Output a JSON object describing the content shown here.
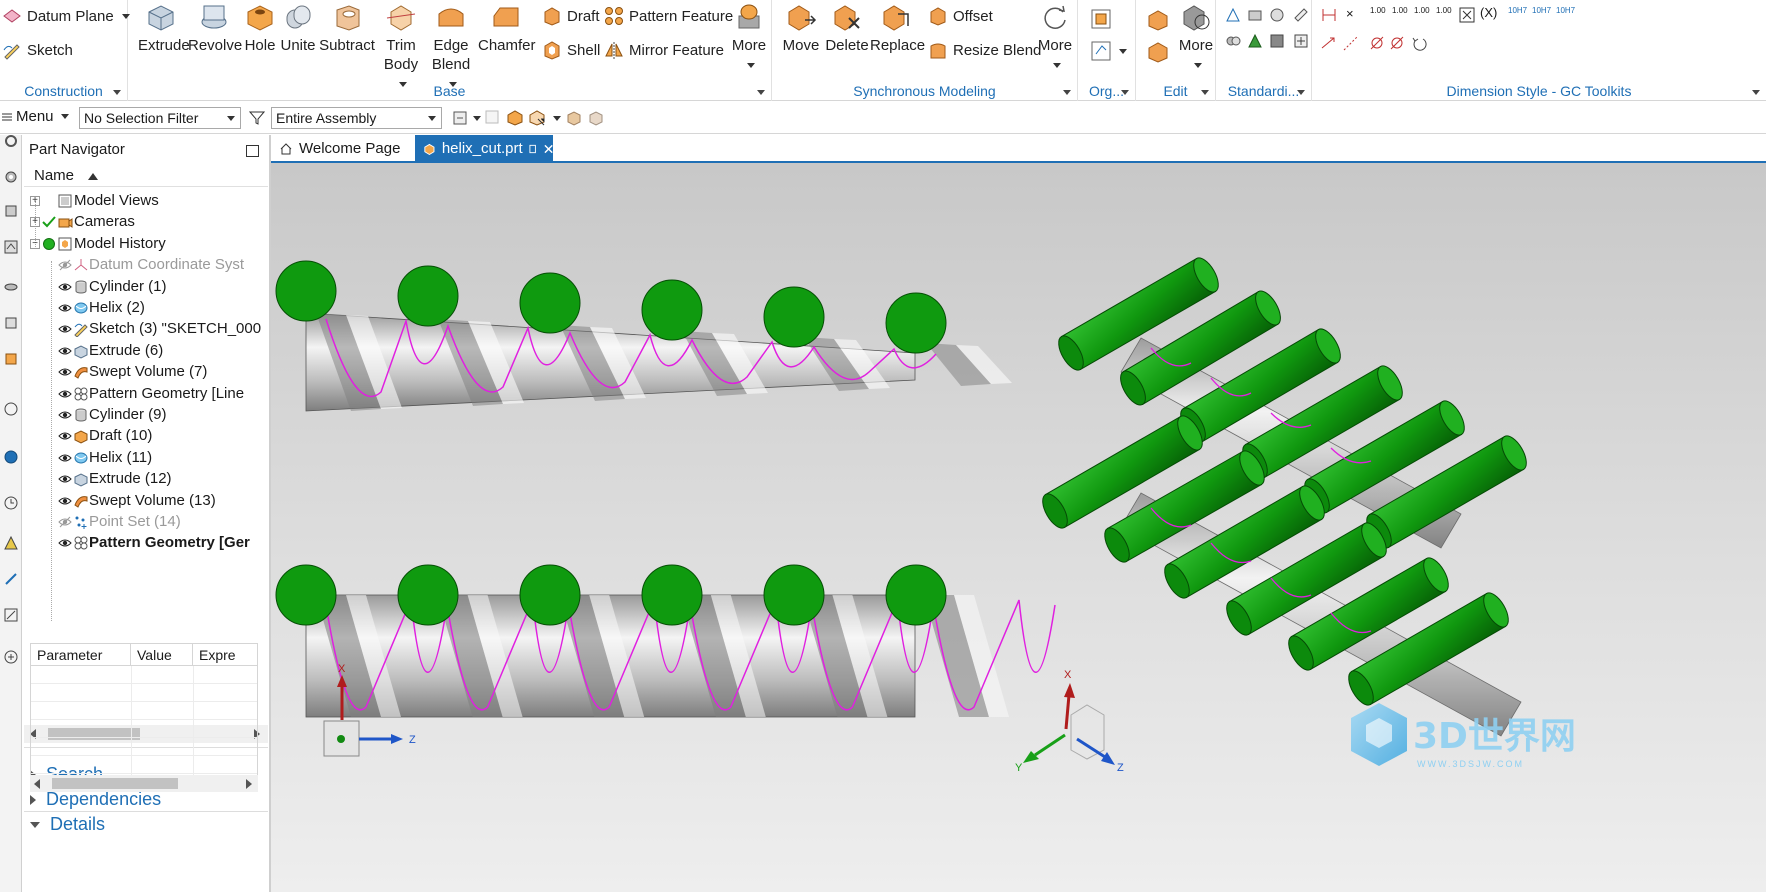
{
  "ribbon": {
    "construction": {
      "datum_plane": "Datum Plane",
      "sketch": "Sketch",
      "group_label": "Construction"
    },
    "base": {
      "extrude": "Extrude",
      "revolve": "Revolve",
      "hole": "Hole",
      "unite": "Unite",
      "subtract": "Subtract",
      "trim_body_1": "Trim",
      "trim_body_2": "Body",
      "edge_blend_1": "Edge",
      "edge_blend_2": "Blend",
      "chamfer": "Chamfer",
      "draft": "Draft",
      "shell": "Shell",
      "pattern_feature": "Pattern Feature",
      "mirror_feature": "Mirror Feature",
      "more": "More",
      "group_label": "Base"
    },
    "sync": {
      "move": "Move",
      "delete": "Delete",
      "replace": "Replace",
      "offset": "Offset",
      "resize_blend": "Resize Blend",
      "more": "More",
      "group_label": "Synchronous Modeling"
    },
    "org": {
      "group_label": "Org..."
    },
    "edit": {
      "more": "More",
      "group_label": "Edit"
    },
    "standard": {
      "group_label": "Standardi..."
    },
    "dimstyle": {
      "group_label": "Dimension Style - GC Toolkits",
      "tol_label_1": "1.00",
      "tol_label_2": "1.00",
      "tol_label_3": "1.00",
      "tol_label_4": "1.00",
      "fit_1": "10H7",
      "fit_2": "10H7",
      "fit_3": "10H7"
    }
  },
  "selection_bar": {
    "menu": "Menu",
    "selection_filter": "No Selection Filter",
    "scope": "Entire Assembly"
  },
  "navigator": {
    "title": "Part Navigator",
    "column_name": "Name",
    "items": [
      {
        "label": "Model Views"
      },
      {
        "label": "Cameras"
      },
      {
        "label": "Model History"
      },
      {
        "label": "Datum Coordinate Syst"
      },
      {
        "label": "Cylinder (1)"
      },
      {
        "label": "Helix (2)"
      },
      {
        "label": "Sketch (3) \"SKETCH_000"
      },
      {
        "label": "Extrude (6)"
      },
      {
        "label": "Swept Volume (7)"
      },
      {
        "label": "Pattern Geometry [Line"
      },
      {
        "label": "Cylinder (9)"
      },
      {
        "label": "Draft (10)"
      },
      {
        "label": "Helix (11)"
      },
      {
        "label": "Extrude (12)"
      },
      {
        "label": "Swept Volume (13)"
      },
      {
        "label": "Point Set (14)"
      },
      {
        "label": "Pattern Geometry [Ger"
      }
    ],
    "search": "Search",
    "dependencies": "Dependencies",
    "details": "Details",
    "details_columns": [
      "Parameter",
      "Value",
      "Expre"
    ]
  },
  "tabs": [
    {
      "label": "Welcome Page"
    },
    {
      "label": "helix_cut.prt"
    }
  ],
  "viewport": {
    "triad_x": "X",
    "triad_z": "Z",
    "triad_x2": "X",
    "triad_y2": "Y",
    "triad_z2": "Z",
    "watermark_main": "3D世界网",
    "watermark_sub": "WWW.3DSJW.COM"
  },
  "colors": {
    "accent": "#1f6fb5",
    "cylinder_green": "#0f9a0f",
    "helix_magenta": "#e020e0",
    "shaft_grey": "#b8b8b8"
  }
}
